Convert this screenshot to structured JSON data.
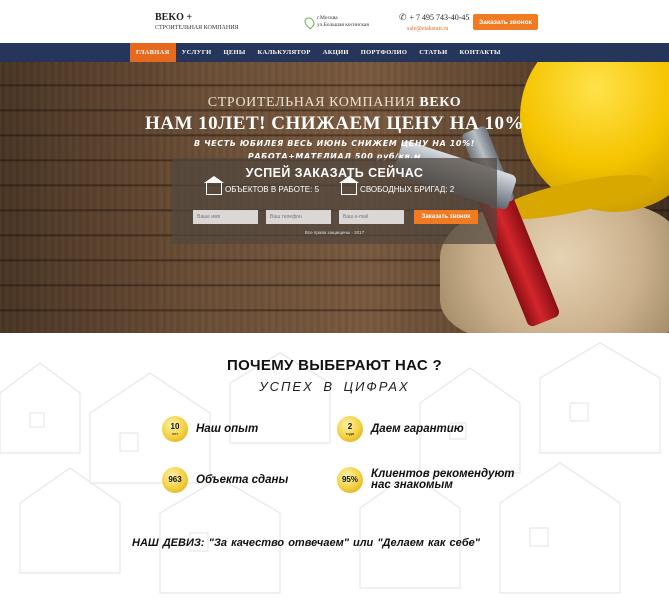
{
  "header": {
    "logo_title": "BEKO +",
    "logo_subtitle": "СТРОИТЕЛЬНАЯ КОМПАНИЯ",
    "address_line1": "г.Москва",
    "address_line2": "ул.Большая косинская",
    "phone": "+ 7 495 743-40-45",
    "email": "sale@etakstati.ru",
    "call_button": "Заказать звонок"
  },
  "nav": {
    "items": [
      {
        "label": "ГЛАВНАЯ",
        "active": true
      },
      {
        "label": "УСЛУГИ",
        "active": false
      },
      {
        "label": "ЦЕНЫ",
        "active": false
      },
      {
        "label": "КАЛЬКУЛЯТОР",
        "active": false
      },
      {
        "label": "АКЦИИ",
        "active": false
      },
      {
        "label": "ПОРТФОЛИО",
        "active": false
      },
      {
        "label": "СТАТЬИ",
        "active": false
      },
      {
        "label": "КОНТАКТЫ",
        "active": false
      }
    ]
  },
  "hero": {
    "line1_prefix": "СТРОИТЕЛЬНАЯ КОМПАНИЯ",
    "line1_brand": "ВЕКО",
    "line2": "НАМ 10ЛЕТ! СНИЖАЕМ ЦЕНУ НА 10%",
    "line3": "В ЧЕСТЬ ЮБИЛЕЯ ВЕСЬ ИЮНЬ СНИЖЕМ ЦЕНУ НА 10%!",
    "line4": "РАБОТА+МАТЕЛИАЛ 500 руб/кв.м"
  },
  "order_form": {
    "title": "УСПЕЙ ЗАКАЗАТЬ СЕЙЧАС",
    "stat_objects": "ОБЪЕКТОВ В РАБОТЕ: 5",
    "stat_brigades": "СВОБОДНЫХ БРИГАД: 2",
    "input1_placeholder": "Ваше имя",
    "input2_placeholder": "Ваш телефон",
    "input3_placeholder": "Ваш e-mail",
    "submit": "Заказать звонок",
    "copyright": "Все права защищены · 2017"
  },
  "why": {
    "title": "ПОЧЕМУ ВЫБЕРАЮТ НАС ?",
    "subtitle": "УСПЕХ В ЦИФРАХ",
    "features": [
      {
        "num": "10",
        "unit": "лет",
        "label": "Наш опыт"
      },
      {
        "num": "2",
        "unit": "года",
        "label": "Даем гарантию"
      },
      {
        "num": "963",
        "unit": "",
        "label": "Объекта сданы"
      },
      {
        "num": "95%",
        "unit": "",
        "label": "Клиентов  рекомендуют нас знакомым"
      }
    ],
    "motto": "НАШ ДЕВИЗ: \"За качество отвечаем\"  или  \"Делаем как себе\""
  },
  "colors": {
    "nav_bg": "#26365a",
    "accent": "#f07b22",
    "badge": "#f3cf3f"
  }
}
